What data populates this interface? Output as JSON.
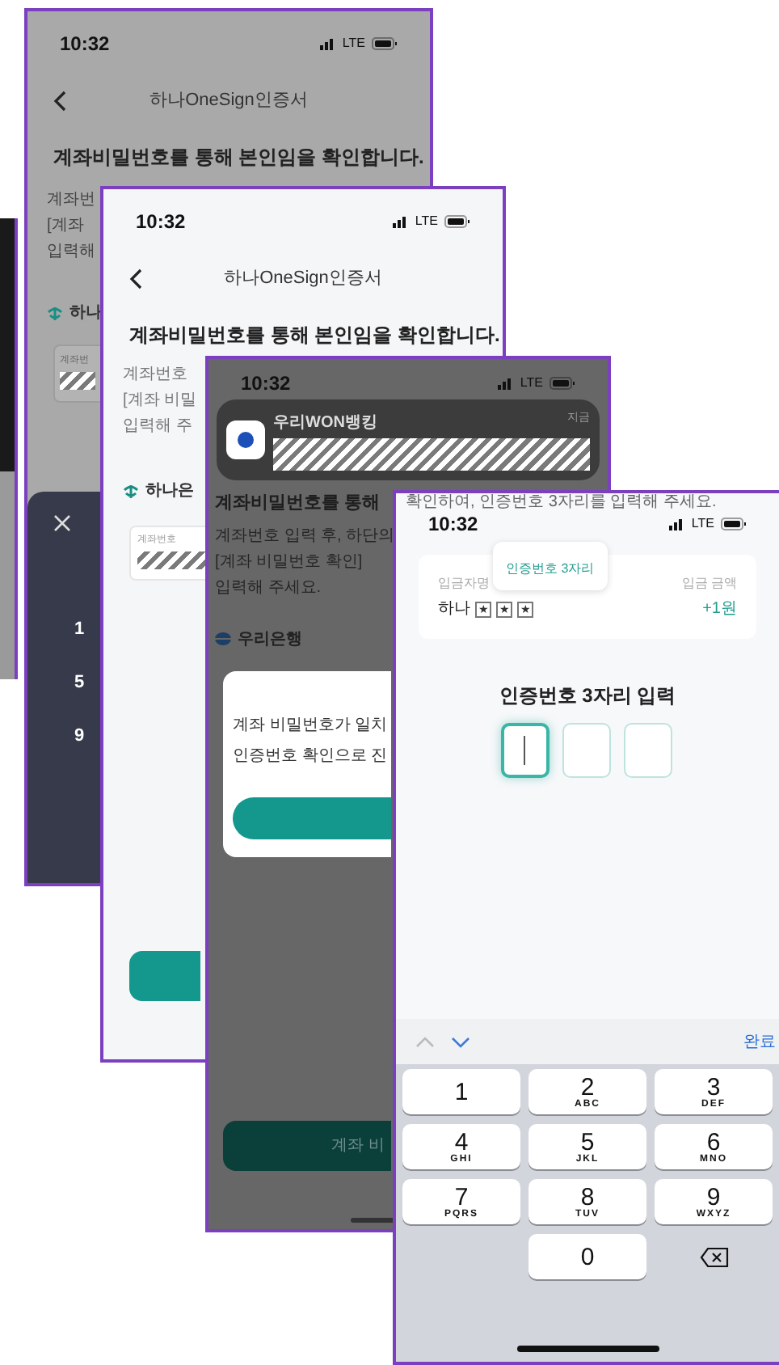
{
  "back_screen": {
    "time": "10:32",
    "network": "LTE",
    "title": "하나OneSign인증서",
    "heading": "계좌비밀번호를 통해 본인임을 확인합니다.",
    "desc_lines": [
      "계좌번",
      "[계좌",
      "입력해"
    ],
    "bank_name": "하나",
    "field_label": "계좌번",
    "keypad_keys": [
      "1",
      "5",
      "9"
    ]
  },
  "middle_screen": {
    "time": "10:32",
    "network": "LTE",
    "title": "하나OneSign인증서",
    "heading": "계좌비밀번호를 통해 본인임을 확인합니다.",
    "desc_lines": [
      "계좌번호",
      "[계좌 비밀",
      "입력해 주"
    ],
    "bank_name": "하나은",
    "field_label": "계좌번호"
  },
  "notification_screen": {
    "time": "10:32",
    "network": "LTE",
    "notification": {
      "app": "우리WON뱅킹",
      "time": "지금"
    },
    "heading": "계좌비밀번호를 통해",
    "desc_lines": [
      "계좌번호 입력 후, 하단의",
      "[계좌 비밀번호 확인]",
      "입력해 주세요."
    ],
    "bank_name": "우리은행",
    "dialog_lines": [
      "계좌 비밀번호가 일치",
      "인증번호 확인으로 진"
    ],
    "button": "계좌 비"
  },
  "front_screen": {
    "overlay_text": "확인하여, 인증번호 3자리를 입력해 주세요.",
    "time": "10:32",
    "network": "LTE",
    "tooltip": "인증번호 3자리",
    "depositor_label": "입금자명",
    "amount_label": "입금 금액",
    "depositor": "하나",
    "masked": [
      "★",
      "★",
      "★"
    ],
    "amount": "+1원",
    "heading": "인증번호 3자리 입력",
    "code_boxes": [
      {
        "focused": true
      },
      {
        "focused": false
      },
      {
        "focused": false
      }
    ],
    "keyboard": {
      "done": "완료",
      "keys": [
        {
          "kind": "digit",
          "digit": "1"
        },
        {
          "kind": "digit",
          "digit": "2",
          "letters": "ABC"
        },
        {
          "kind": "digit",
          "digit": "3",
          "letters": "DEF"
        },
        {
          "kind": "digit",
          "digit": "4",
          "letters": "GHI"
        },
        {
          "kind": "digit",
          "digit": "5",
          "letters": "JKL"
        },
        {
          "kind": "digit",
          "digit": "6",
          "letters": "MNO"
        },
        {
          "kind": "digit",
          "digit": "7",
          "letters": "PQRS"
        },
        {
          "kind": "digit",
          "digit": "8",
          "letters": "TUV"
        },
        {
          "kind": "digit",
          "digit": "9",
          "letters": "WXYZ"
        },
        {
          "kind": "blank"
        },
        {
          "kind": "digit",
          "digit": "0"
        },
        {
          "kind": "delete"
        }
      ]
    }
  }
}
